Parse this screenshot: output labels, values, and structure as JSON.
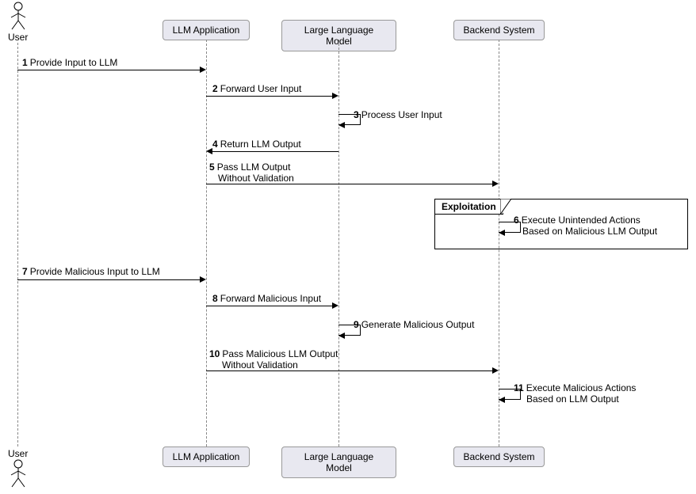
{
  "actors": {
    "user_top": "User",
    "user_bottom": "User"
  },
  "participants": {
    "llm_app_top": "LLM Application",
    "llm_top": "Large Language Model",
    "backend_top": "Backend System",
    "llm_app_bottom": "LLM Application",
    "llm_bottom": "Large Language Model",
    "backend_bottom": "Backend System"
  },
  "frame": {
    "label": "Exploitation"
  },
  "messages": {
    "m1": {
      "num": "1",
      "text": "Provide Input to LLM"
    },
    "m2": {
      "num": "2",
      "text": "Forward User Input"
    },
    "m3": {
      "num": "3",
      "text": "Process User Input"
    },
    "m4": {
      "num": "4",
      "text": "Return LLM Output"
    },
    "m5": {
      "num": "5",
      "line1": "Pass LLM Output",
      "line2": "Without Validation"
    },
    "m6": {
      "num": "6",
      "line1": "Execute Unintended Actions",
      "line2": "Based on Malicious LLM Output"
    },
    "m7": {
      "num": "7",
      "text": "Provide Malicious Input to LLM"
    },
    "m8": {
      "num": "8",
      "text": "Forward Malicious Input"
    },
    "m9": {
      "num": "9",
      "text": "Generate Malicious Output"
    },
    "m10": {
      "num": "10",
      "line1": "Pass Malicious LLM Output",
      "line2": "Without Validation"
    },
    "m11": {
      "num": "11",
      "line1": "Execute Malicious Actions",
      "line2": "Based on LLM Output"
    }
  },
  "chart_data": {
    "type": "sequence_diagram",
    "actors": [
      "User"
    ],
    "participants": [
      "LLM Application",
      "Large Language Model",
      "Backend System"
    ],
    "frames": [
      {
        "label": "Exploitation",
        "covers_steps": [
          6
        ]
      }
    ],
    "steps": [
      {
        "n": 1,
        "from": "User",
        "to": "LLM Application",
        "label": "Provide Input to LLM",
        "type": "sync"
      },
      {
        "n": 2,
        "from": "LLM Application",
        "to": "Large Language Model",
        "label": "Forward User Input",
        "type": "sync"
      },
      {
        "n": 3,
        "from": "Large Language Model",
        "to": "Large Language Model",
        "label": "Process User Input",
        "type": "self"
      },
      {
        "n": 4,
        "from": "Large Language Model",
        "to": "LLM Application",
        "label": "Return LLM Output",
        "type": "sync"
      },
      {
        "n": 5,
        "from": "LLM Application",
        "to": "Backend System",
        "label": "Pass LLM Output Without Validation",
        "type": "sync"
      },
      {
        "n": 6,
        "from": "Backend System",
        "to": "Backend System",
        "label": "Execute Unintended Actions Based on Malicious LLM Output",
        "type": "self"
      },
      {
        "n": 7,
        "from": "User",
        "to": "LLM Application",
        "label": "Provide Malicious Input to LLM",
        "type": "sync"
      },
      {
        "n": 8,
        "from": "LLM Application",
        "to": "Large Language Model",
        "label": "Forward Malicious Input",
        "type": "sync"
      },
      {
        "n": 9,
        "from": "Large Language Model",
        "to": "Large Language Model",
        "label": "Generate Malicious Output",
        "type": "self"
      },
      {
        "n": 10,
        "from": "LLM Application",
        "to": "Backend System",
        "label": "Pass Malicious LLM Output Without Validation",
        "type": "sync"
      },
      {
        "n": 11,
        "from": "Backend System",
        "to": "Backend System",
        "label": "Execute Malicious Actions Based on LLM Output",
        "type": "self"
      }
    ]
  }
}
